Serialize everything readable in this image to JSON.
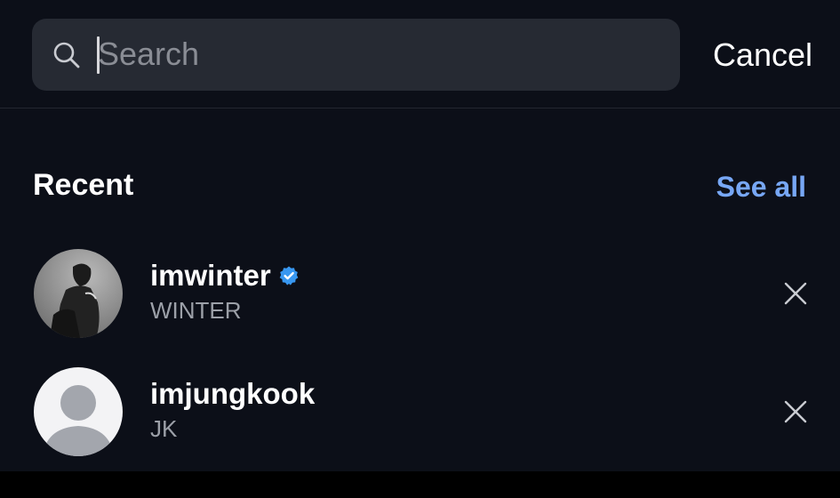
{
  "search": {
    "placeholder": "Search",
    "value": ""
  },
  "header": {
    "cancel_label": "Cancel"
  },
  "recent": {
    "title": "Recent",
    "see_all_label": "See all",
    "items": [
      {
        "username": "imwinter",
        "fullname": "WINTER",
        "verified": true,
        "avatar": "photo"
      },
      {
        "username": "imjungkook",
        "fullname": "JK",
        "verified": false,
        "avatar": "default-silhouette"
      }
    ]
  },
  "colors": {
    "background": "#0c0f18",
    "search_field": "#262a33",
    "link_accent": "#77a7f5",
    "verified_badge": "#3897f0",
    "secondary_text": "#9ca0a8"
  },
  "icons": {
    "search": "search-icon",
    "remove": "close-icon",
    "verified": "verified-badge-icon"
  }
}
